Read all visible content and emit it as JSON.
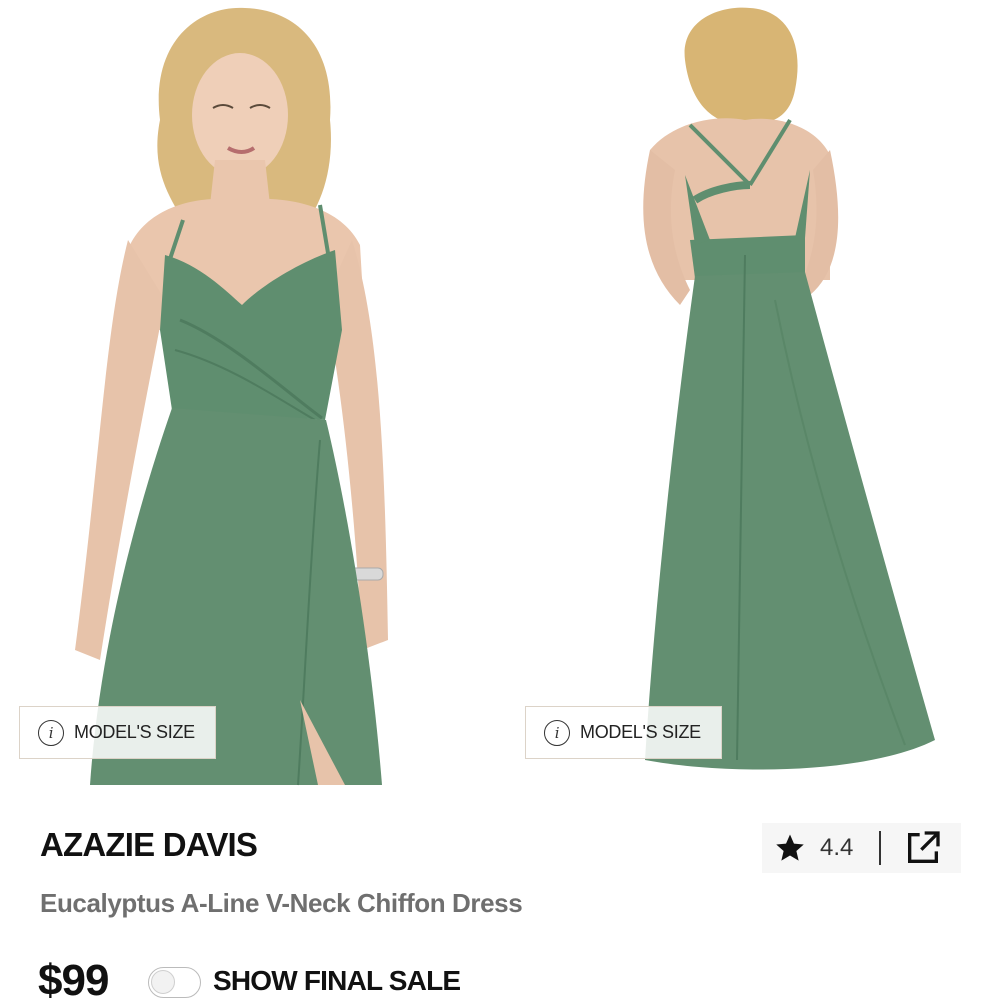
{
  "gallery": {
    "images": [
      {
        "alt": "front view",
        "size_badge": "MODEL'S SIZE"
      },
      {
        "alt": "back view",
        "size_badge": "MODEL'S SIZE"
      }
    ],
    "dress_color": "#5f8e6f"
  },
  "product": {
    "brand": "AZAZIE DAVIS",
    "name": "Eucalyptus A-Line V-Neck Chiffon Dress",
    "price": "$99",
    "rating": "4.4",
    "final_sale_label": "SHOW FINAL SALE",
    "final_sale_enabled": false
  },
  "icons": {
    "info": "info-icon",
    "rating": "star-icon",
    "share": "external-link-icon"
  }
}
